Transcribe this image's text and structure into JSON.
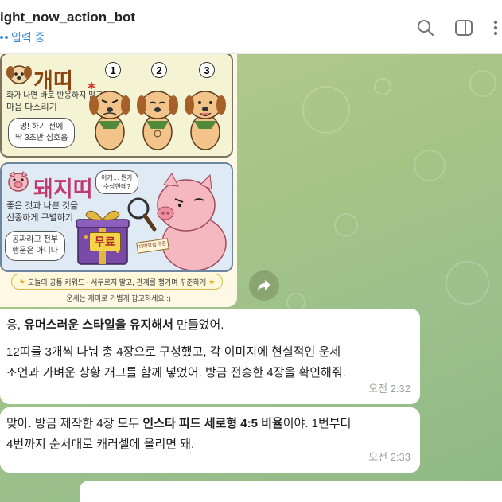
{
  "header": {
    "bot_name": "ight_now_action_bot",
    "status": "입력 중"
  },
  "image": {
    "dog_panel": {
      "title": "개띠",
      "advice_line1": "화가 나면 바로 반응하지 말고",
      "advice_line2": "마음 다스리기",
      "speech_line1": "멍! 하기 전에",
      "speech_line2": "딱 3초만 심호흡",
      "steps": [
        "1",
        "2",
        "3"
      ]
    },
    "pig_panel": {
      "title": "돼지띠",
      "advice_line1": "좋은 것과 나쁜 것을",
      "advice_line2": "신중하게 구별하기",
      "thought_line1": "이거… 뭔가",
      "thought_line2": "수상한데?",
      "speech_line1": "공짜라고 전부",
      "speech_line2": "행운은 아니다",
      "gift_tag": "무료",
      "small_tag": "대박당첨 쿠폰"
    },
    "keyword": "오늘의 공통 키워드 · 서두르지 말고, 관계를 챙기며 꾸준하게",
    "footnote": "운세는 재미로 가볍게 참고하세요 :)"
  },
  "messages": [
    {
      "p1_prefix": "응, ",
      "p1_bold": "유머스러운 스타일을 유지해서",
      "p1_suffix": " 만들었어.",
      "p2_line1": "12띠를 3개씩 나눠 총 4장으로 구성했고, 각 이미지에 현실적인 운세",
      "p2_line2": "조언과 가벼운 상황 개그를 함께 넣었어. 방금 전송한 4장을 확인해줘.",
      "time": "오전 2:32"
    },
    {
      "l1_prefix": "맞아. 방금 제작한 4장 모두 ",
      "l1_bold": "인스타 피드 세로형 4:5 비율",
      "l1_suffix": "이야. 1번부터",
      "line2": "4번까지 순서대로 캐러셀에 올리면 돼.",
      "time": "오전 2:33"
    }
  ],
  "colors": {
    "accent": "#3a8fd1",
    "chat_background": "#a6c585",
    "bubble": "#ffffff",
    "timestamp": "#9aa39a"
  },
  "icons": [
    "search-icon",
    "sidebar-toggle-icon",
    "more-vertical-icon",
    "forward-icon",
    "dog-face-icon",
    "pig-face-icon",
    "magnifier-icon",
    "gift-box-icon",
    "star-icon"
  ]
}
